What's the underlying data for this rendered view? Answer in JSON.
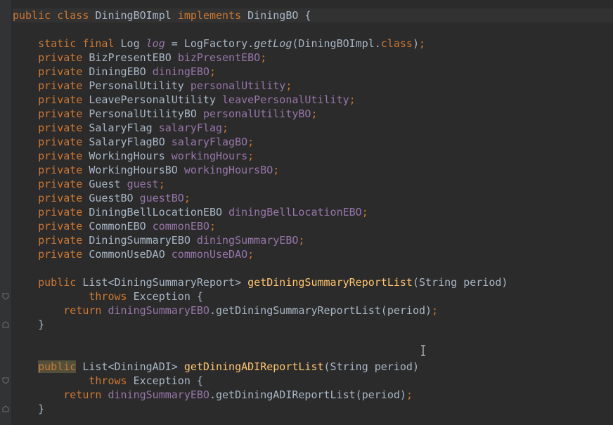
{
  "editor": {
    "line1": {
      "kw_public": "public",
      "kw_class": "class",
      "name": "DiningBOImpl",
      "kw_impl": "implements",
      "iface": "DiningBO",
      "brace": "{"
    },
    "log": {
      "kw_static": "static",
      "kw_final": "final",
      "type": "Log",
      "field": "log",
      "eq": "=",
      "factory": "LogFactory.",
      "get": "getLog",
      "arg": "(DiningBOImpl.",
      "cls": "class",
      "close": ")",
      "semi": ";"
    },
    "fields": [
      {
        "kw": "private",
        "type": "BizPresentEBO",
        "name": "bizPresentEBO"
      },
      {
        "kw": "private",
        "type": "DiningEBO",
        "name": "diningEBO"
      },
      {
        "kw": "private",
        "type": "PersonalUtility",
        "name": "personalUtility"
      },
      {
        "kw": "private",
        "type": "LeavePersonalUtility",
        "name": "leavePersonalUtility"
      },
      {
        "kw": "private",
        "type": "PersonalUtilityBO",
        "name": "personalUtilityBO"
      },
      {
        "kw": "private",
        "type": "SalaryFlag",
        "name": "salaryFlag"
      },
      {
        "kw": "private",
        "type": "SalaryFlagBO",
        "name": "salaryFlagBO"
      },
      {
        "kw": "private",
        "type": "WorkingHours",
        "name": "workingHours"
      },
      {
        "kw": "private",
        "type": "WorkingHoursBO",
        "name": "workingHoursBO"
      },
      {
        "kw": "private",
        "type": "Guest",
        "name": "guest"
      },
      {
        "kw": "private",
        "type": "GuestBO",
        "name": "guestBO"
      },
      {
        "kw": "private",
        "type": "DiningBellLocationEBO",
        "name": "diningBellLocationEBO"
      },
      {
        "kw": "private",
        "type": "CommonEBO",
        "name": "commonEBO"
      },
      {
        "kw": "private",
        "type": "DiningSummaryEBO",
        "name": "diningSummaryEBO"
      },
      {
        "kw": "private",
        "type": "CommonUseDAO",
        "name": "commonUseDAO"
      }
    ],
    "m1": {
      "kw": "public",
      "ret": "List<DiningSummaryReport>",
      "name": "getDiningSummaryReportList",
      "params": "(String period)",
      "throws": "throws",
      "exc": "Exception {",
      "kw_return": "return",
      "call_field": "diningSummaryEBO",
      "call": ".getDiningSummaryReportList(period)",
      "semi": ";",
      "close": "}"
    },
    "m2": {
      "kw": "public",
      "ret": "List<DiningADI>",
      "name": "getDiningADIReportList",
      "params": "(String period)",
      "throws": "throws",
      "exc": "Exception {",
      "kw_return": "return",
      "call_field": "diningSummaryEBO",
      "call": ".getDiningADIReportList(period)",
      "semi": ";",
      "close": "}"
    }
  },
  "colors": {
    "background": "#2b2b2b",
    "keyword": "#cc7832",
    "field": "#9876aa",
    "method": "#ffc66d",
    "text": "#a9b7c6"
  },
  "icons": [
    "fold-marker-icon",
    "text-cursor-icon"
  ]
}
